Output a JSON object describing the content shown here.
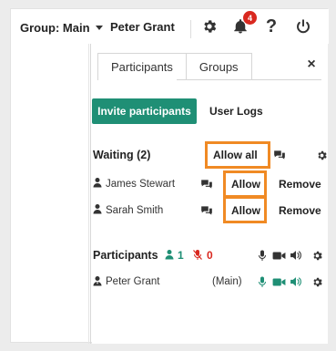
{
  "header": {
    "group_label": "Group: Main",
    "user_name": "Peter Grant",
    "notification_count": "4"
  },
  "panel": {
    "tabs": [
      {
        "label": "Participants",
        "active": true
      },
      {
        "label": "Groups",
        "active": false
      }
    ],
    "close_label": "×",
    "invite_label": "Invite participants",
    "logs_label": "User Logs",
    "waiting": {
      "title": "Waiting (2)",
      "allow_all_label": "Allow all",
      "people": [
        {
          "name": "James Stewart",
          "allow_label": "Allow",
          "remove_label": "Remove"
        },
        {
          "name": "Sarah Smith",
          "allow_label": "Allow",
          "remove_label": "Remove"
        }
      ]
    },
    "participants": {
      "title": "Participants",
      "online_count": "1",
      "muted_count": "0",
      "people": [
        {
          "name": "Peter Grant",
          "group": "(Main)"
        }
      ]
    }
  },
  "colors": {
    "accent": "#1f8f75",
    "alert": "#d9281f",
    "highlight": "#f08a24"
  }
}
